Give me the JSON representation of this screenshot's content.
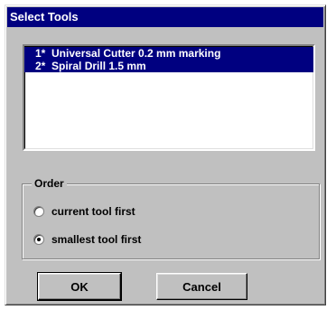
{
  "dialog": {
    "title": "Select Tools"
  },
  "tools": [
    {
      "label": "1*  Universal Cutter 0.2 mm marking",
      "selected": true
    },
    {
      "label": "2*  Spiral Drill 1.5 mm",
      "selected": true
    }
  ],
  "order": {
    "label": "Order",
    "options": [
      {
        "label": "current tool first",
        "checked": false
      },
      {
        "label": "smallest tool first",
        "checked": true
      }
    ]
  },
  "buttons": {
    "ok": "OK",
    "cancel": "Cancel"
  },
  "colors": {
    "titlebar": "#000080",
    "selection": "#000080",
    "face": "#c0c0c0"
  }
}
